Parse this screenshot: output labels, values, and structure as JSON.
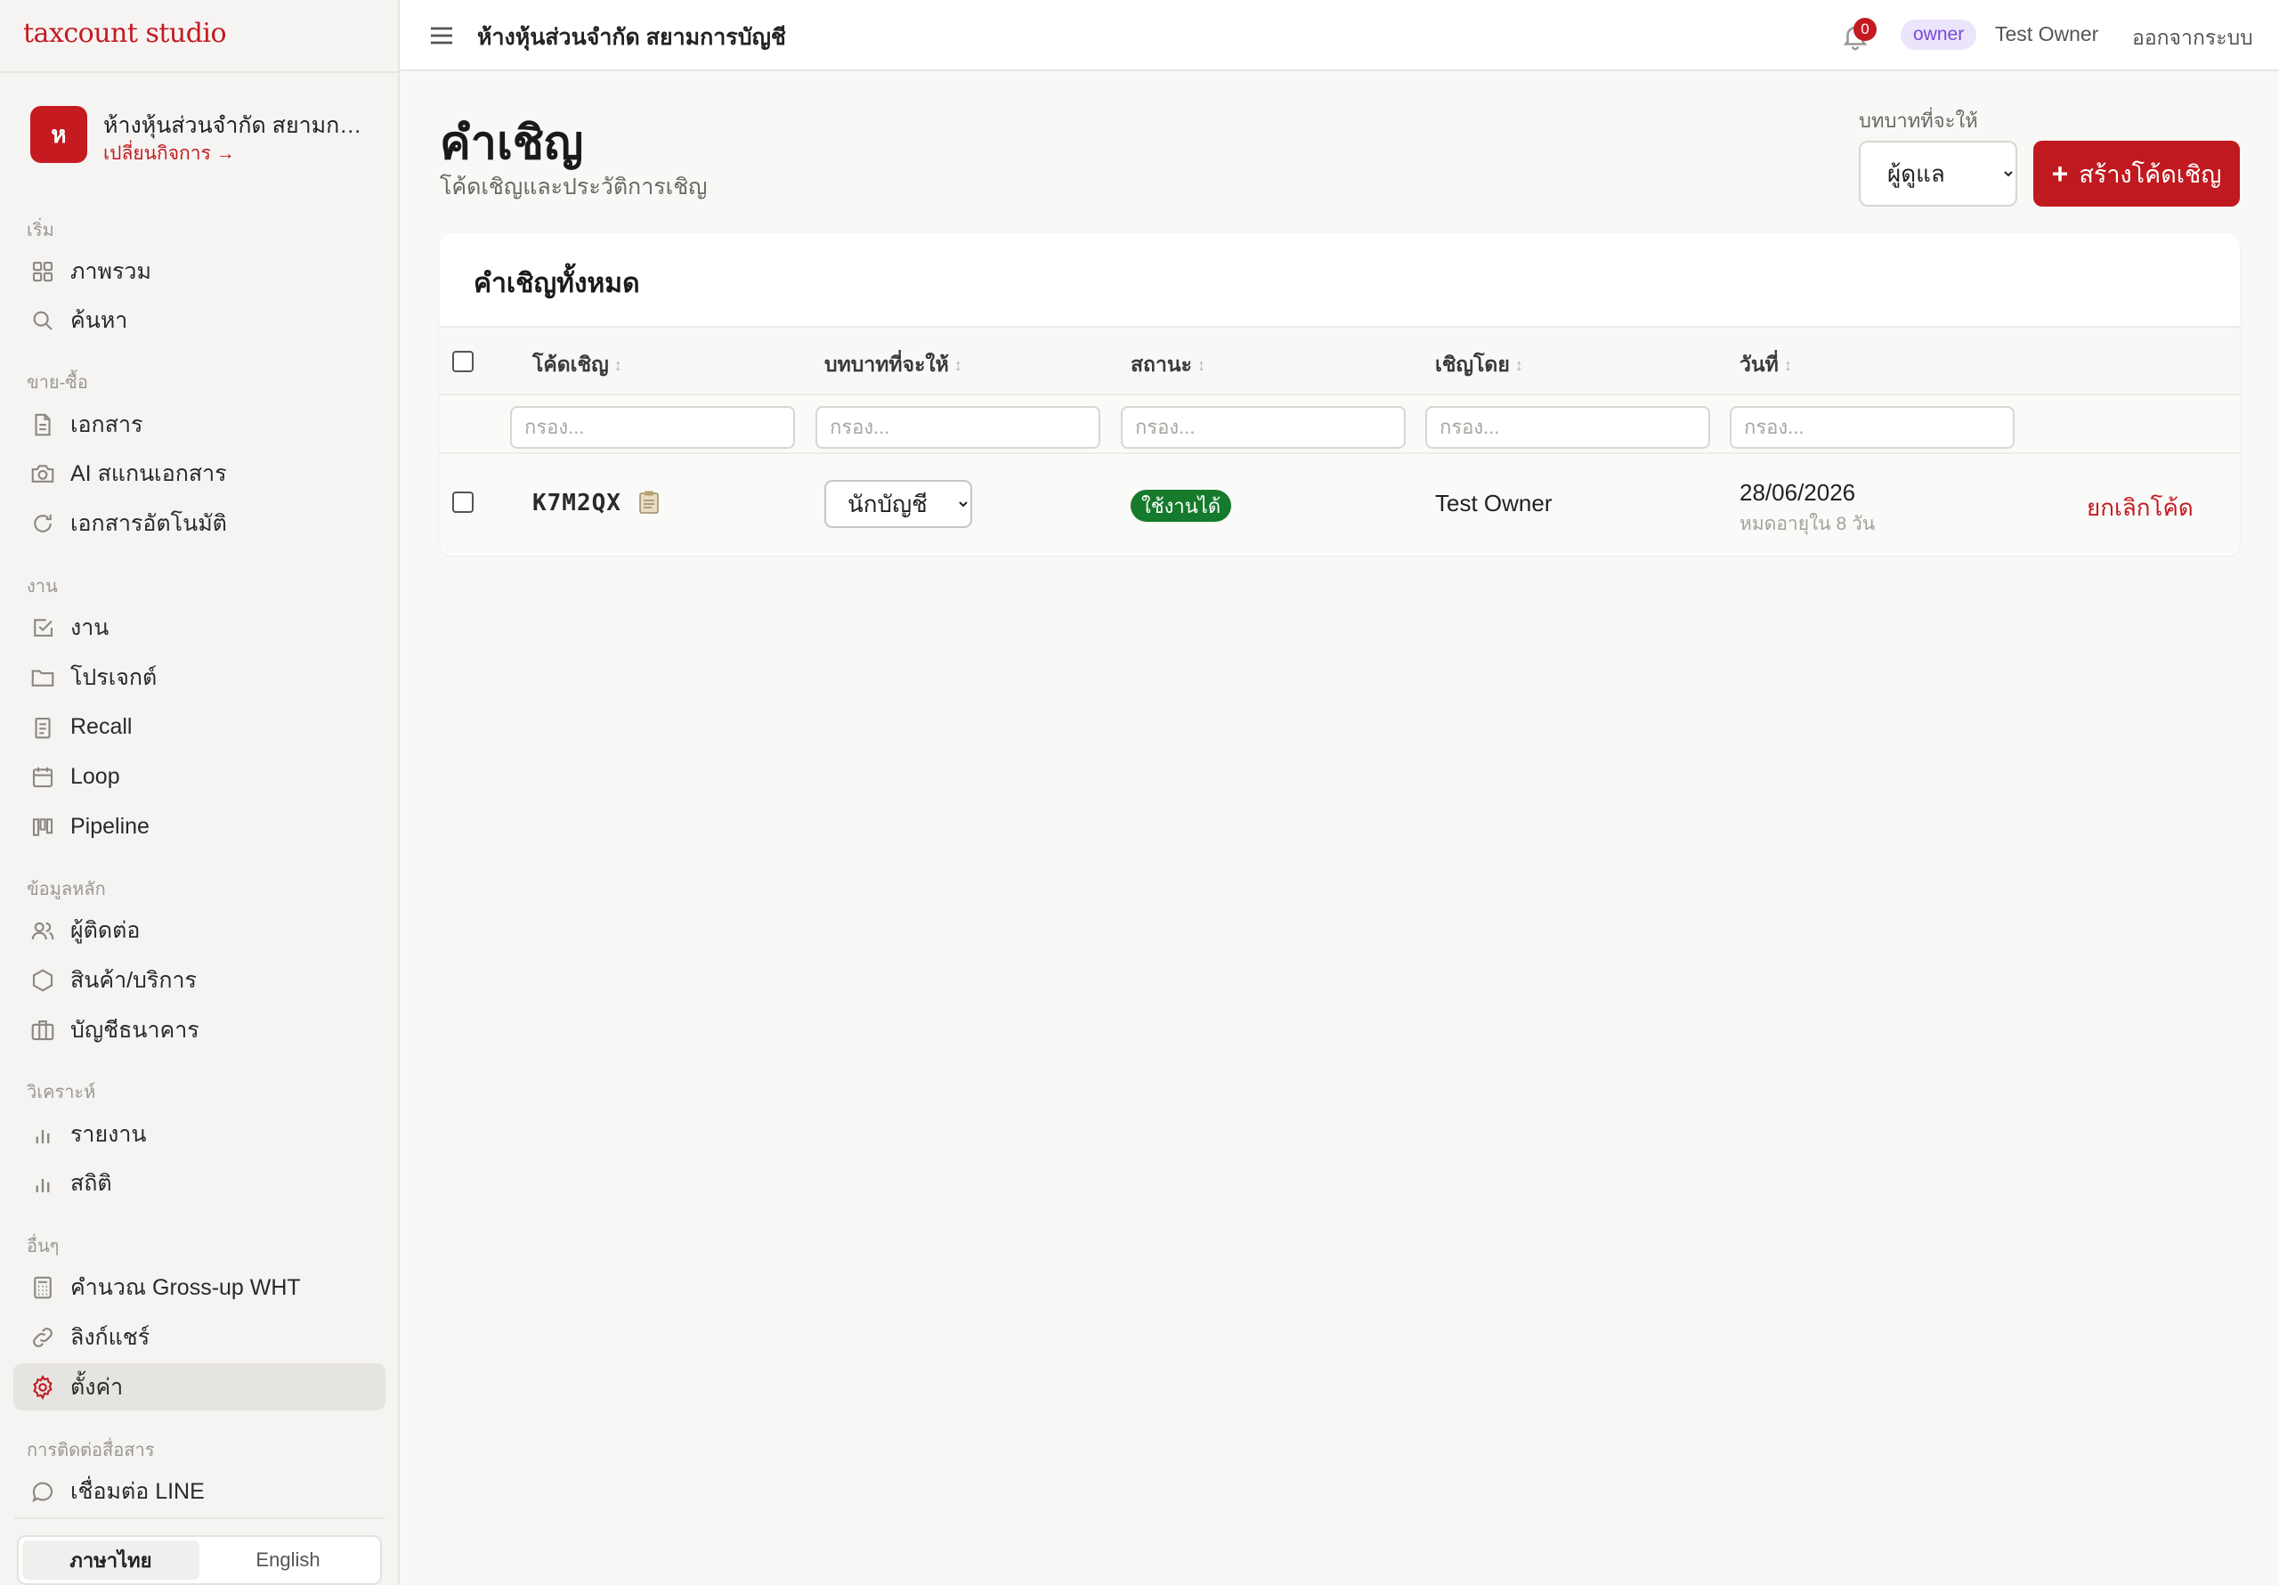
{
  "app": {
    "brand": "taxcount studio"
  },
  "org": {
    "avatar_letter": "ห",
    "name": "ห้างหุ้นส่วนจำกัด สยามการ...",
    "switch_label": "เปลี่ยนกิจการ →"
  },
  "sidebar": {
    "sections": [
      {
        "title": "เริ่ม",
        "items": [
          {
            "label": "ภาพรวม",
            "icon": "grid-icon"
          },
          {
            "label": "ค้นหา",
            "icon": "search-icon"
          }
        ]
      },
      {
        "title": "ขาย-ซื้อ",
        "items": [
          {
            "label": "เอกสาร",
            "icon": "document-icon"
          },
          {
            "label": "AI สแกนเอกสาร",
            "icon": "camera-icon"
          },
          {
            "label": "เอกสารอัตโนมัติ",
            "icon": "refresh-icon"
          }
        ]
      },
      {
        "title": "งาน",
        "items": [
          {
            "label": "งาน",
            "icon": "checkbox-icon"
          },
          {
            "label": "โปรเจกต์",
            "icon": "folder-icon"
          },
          {
            "label": "Recall",
            "icon": "clipboard-icon"
          },
          {
            "label": "Loop",
            "icon": "calendar-icon"
          },
          {
            "label": "Pipeline",
            "icon": "kanban-icon"
          }
        ]
      },
      {
        "title": "ข้อมูลหลัก",
        "items": [
          {
            "label": "ผู้ติดต่อ",
            "icon": "users-icon"
          },
          {
            "label": "สินค้า/บริการ",
            "icon": "box-icon"
          },
          {
            "label": "บัญชีธนาคาร",
            "icon": "briefcase-icon"
          }
        ]
      },
      {
        "title": "วิเคราะห์",
        "items": [
          {
            "label": "รายงาน",
            "icon": "bar-chart-icon"
          },
          {
            "label": "สถิติ",
            "icon": "bar-chart-icon"
          }
        ]
      },
      {
        "title": "อื่นๆ",
        "items": [
          {
            "label": "คำนวณ Gross-up WHT",
            "icon": "calculator-icon"
          },
          {
            "label": "ลิงก์แชร์",
            "icon": "link-icon"
          },
          {
            "label": "ตั้งค่า",
            "icon": "gear-icon",
            "active": true
          }
        ]
      },
      {
        "title": "การติดต่อสื่อสาร",
        "items": [
          {
            "label": "เชื่อมต่อ LINE",
            "icon": "chat-icon"
          }
        ]
      }
    ],
    "languages": [
      "ภาษาไทย",
      "English"
    ],
    "active_language": "ภาษาไทย"
  },
  "topbar": {
    "org_name": "ห้างหุ้นส่วนจำกัด สยามการบัญชี",
    "notification_count": "0",
    "role_badge": "owner",
    "user_name": "Test Owner",
    "logout_label": "ออกจากระบบ"
  },
  "page": {
    "title": "คำเชิญ",
    "subtitle": "โค้ดเชิญและประวัติการเชิญ",
    "role_label": "บทบาทที่จะให้",
    "role_selected": "ผู้ดูแล",
    "create_button": "สร้างโค้ดเชิญ"
  },
  "table": {
    "title": "คำเชิญทั้งหมด",
    "columns": [
      "โค้ดเชิญ",
      "บทบาทที่จะให้",
      "สถานะ",
      "เชิญโดย",
      "วันที่"
    ],
    "filter_placeholder": "กรอง...",
    "rows": [
      {
        "code": "K7M2QX",
        "role": "นักบัญชี",
        "status": "ใช้งานได้",
        "invited_by": "Test Owner",
        "date": "28/06/2026",
        "expires": "หมดอายุใน 8 วัน",
        "action": "ยกเลิกโค้ด"
      }
    ]
  },
  "colors": {
    "accent": "#c41a20",
    "status_active": "#167a2c",
    "role_badge_bg": "#ebe4fb",
    "role_badge_text": "#7a4bd6"
  }
}
